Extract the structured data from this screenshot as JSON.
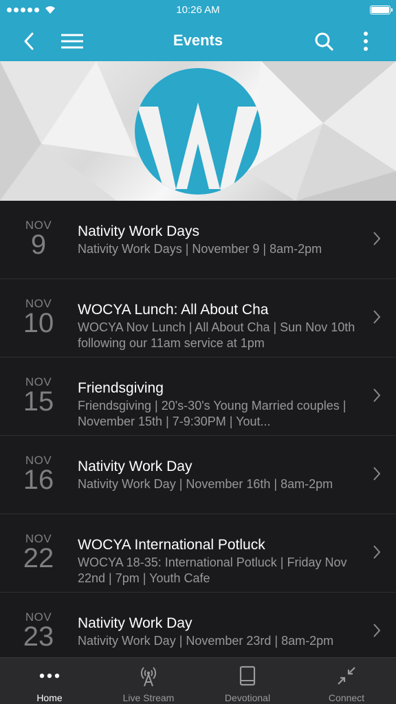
{
  "status_bar": {
    "time": "10:26 AM"
  },
  "header": {
    "title": "Events"
  },
  "events": [
    {
      "month": "NOV",
      "day": "9",
      "title": "Nativity Work Days",
      "desc": "Nativity Work Days | November 9 | 8am-2pm"
    },
    {
      "month": "NOV",
      "day": "10",
      "title": "WOCYA Lunch: All About Cha",
      "desc": "WOCYA Nov Lunch | All About Cha | Sun Nov 10th following our 11am service at 1pm"
    },
    {
      "month": "NOV",
      "day": "15",
      "title": "Friendsgiving",
      "desc": "Friendsgiving | 20's-30's Young Married couples | November 15th | 7-9:30PM | Yout..."
    },
    {
      "month": "NOV",
      "day": "16",
      "title": "Nativity Work Day",
      "desc": "Nativity Work Day | November 16th | 8am-2pm"
    },
    {
      "month": "NOV",
      "day": "22",
      "title": "WOCYA International Potluck",
      "desc": "WOCYA 18-35: International Potluck | Friday Nov 22nd | 7pm | Youth Cafe"
    },
    {
      "month": "NOV",
      "day": "23",
      "title": "Nativity Work Day",
      "desc": "Nativity Work Day | November 23rd | 8am-2pm"
    }
  ],
  "tabs": [
    {
      "label": "Home",
      "icon": "more-dots-icon",
      "active": true
    },
    {
      "label": "Live Stream",
      "icon": "broadcast-icon",
      "active": false
    },
    {
      "label": "Devotional",
      "icon": "book-icon",
      "active": false
    },
    {
      "label": "Connect",
      "icon": "collapse-arrows-icon",
      "active": false
    }
  ],
  "colors": {
    "accent": "#2aa7c9",
    "background": "#1a1a1c",
    "tabbar": "#2a2a2c"
  }
}
